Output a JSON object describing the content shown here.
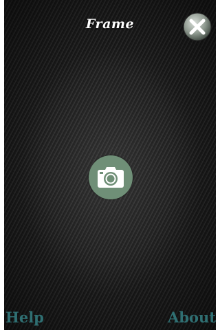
{
  "header": {
    "title": "Frame",
    "close_icon": "close-icon"
  },
  "main": {
    "camera_icon": "camera-icon"
  },
  "footer": {
    "help_label": "Help",
    "about_label": "About"
  },
  "colors": {
    "background": "#1f1f1f",
    "accent": "#6f8f77",
    "link": "#2f6f72",
    "title": "#ffffff"
  }
}
